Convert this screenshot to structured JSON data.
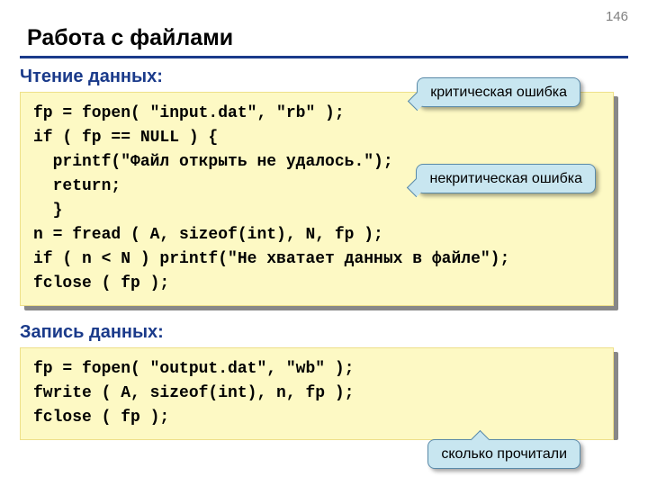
{
  "page_number": "146",
  "title": "Работа с файлами",
  "section1_label": "Чтение данных:",
  "section2_label": "Запись данных:",
  "code1": "fp = fopen( \"input.dat\", \"rb\" );\nif ( fp == NULL ) {\n  printf(\"Файл открыть не удалось.\");\n  return;\n  }\nn = fread ( A, sizeof(int), N, fp );\nif ( n < N ) printf(\"Не хватает данных в файле\");\nfclose ( fp );",
  "code2": "fp = fopen( \"output.dat\", \"wb\" );\nfwrite ( A, sizeof(int), n, fp );\nfclose ( fp );",
  "callout1": "критическая\nошибка",
  "callout2": "некритическая\nошибка",
  "callout3": "сколько\nпрочитали"
}
